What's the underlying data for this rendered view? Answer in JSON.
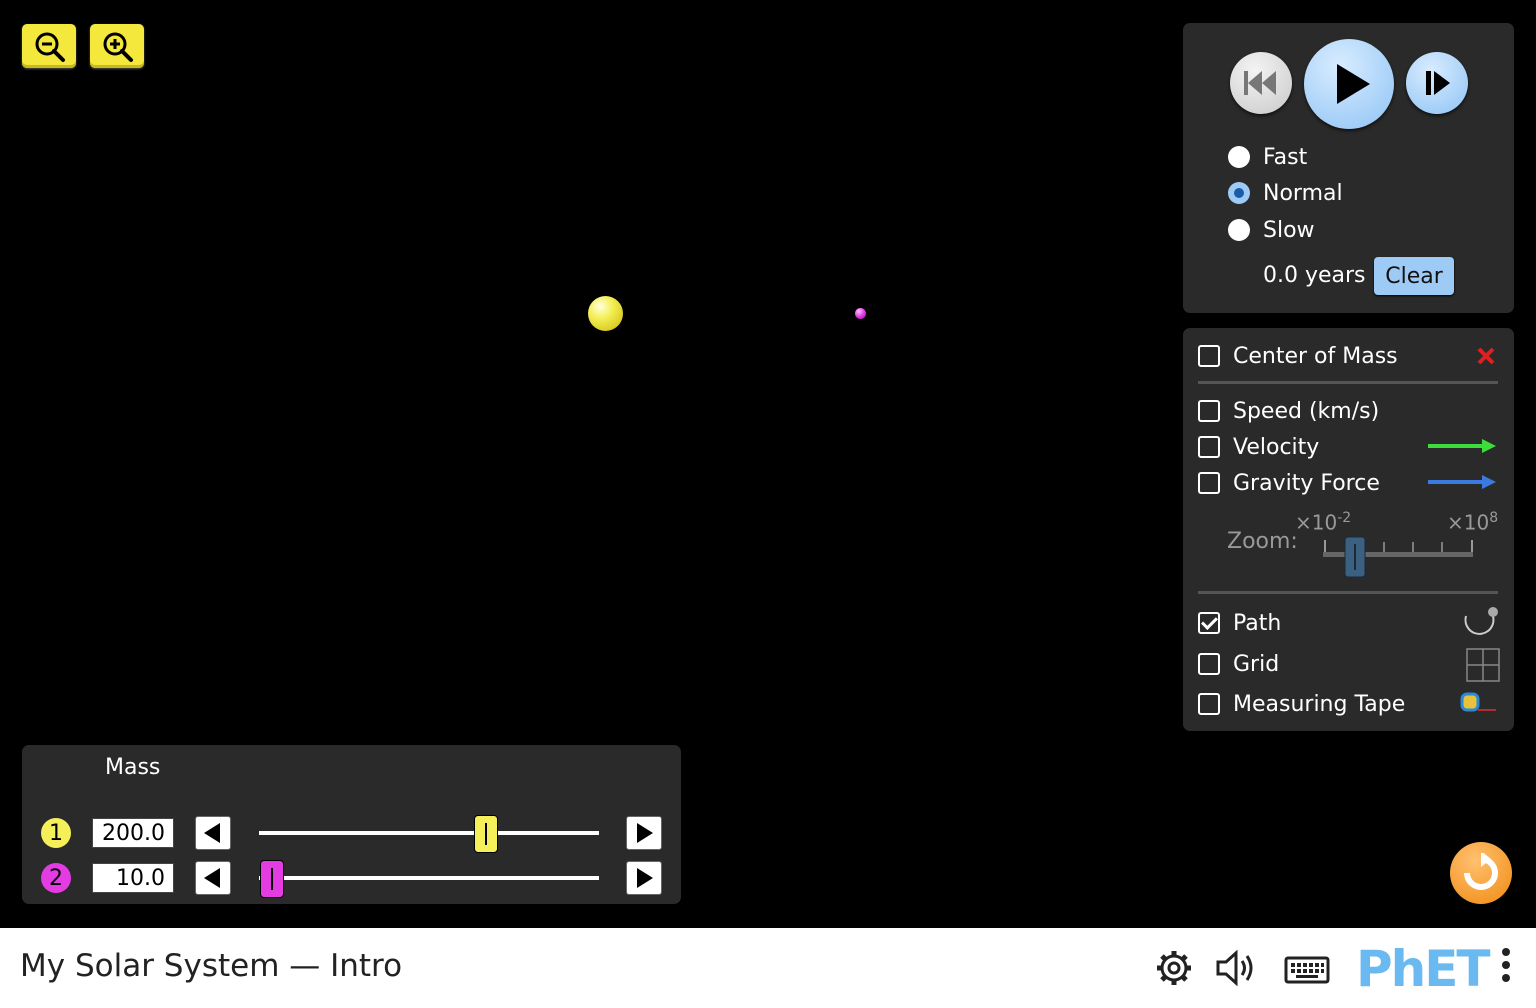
{
  "sim": {
    "title": "My Solar System — Intro"
  },
  "time_panel": {
    "speeds": [
      {
        "label": "Fast",
        "selected": false
      },
      {
        "label": "Normal",
        "selected": true
      },
      {
        "label": "Slow",
        "selected": false
      }
    ],
    "elapsed": "0.0 years",
    "clear_label": "Clear"
  },
  "options_panel": {
    "center_of_mass": {
      "label": "Center of Mass",
      "checked": false
    },
    "speed": {
      "label": "Speed (km/s)",
      "checked": false
    },
    "velocity": {
      "label": "Velocity",
      "checked": false
    },
    "gravity_force": {
      "label": "Gravity Force",
      "checked": false
    },
    "zoom_label": "Zoom:",
    "zoom_min_base": "×10",
    "zoom_min_exp": "-2",
    "zoom_max_base": "×10",
    "zoom_max_exp": "8",
    "path": {
      "label": "Path",
      "checked": true
    },
    "grid": {
      "label": "Grid",
      "checked": false
    },
    "measuring_tape": {
      "label": "Measuring Tape",
      "checked": false
    }
  },
  "mass_panel": {
    "title": "Mass",
    "bodies": [
      {
        "number": "1",
        "value": "200.0",
        "color": "#f5f05a"
      },
      {
        "number": "2",
        "value": "10.0",
        "color": "#e23ce2"
      }
    ]
  },
  "colors": {
    "velocity_arrow": "#3ddc3d",
    "gravity_arrow": "#3b7be0",
    "accent": "#9ecbf5",
    "reset": "#f08a10",
    "phet": "#6ab9f0"
  },
  "navbar": {
    "brand": "PhET"
  }
}
